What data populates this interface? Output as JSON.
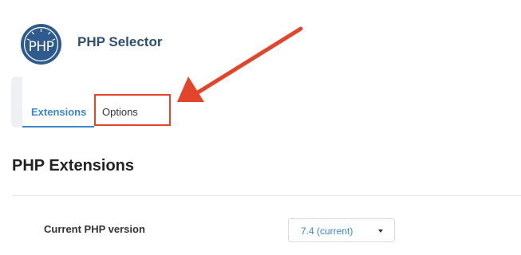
{
  "header": {
    "logo_text": "PHP",
    "logo_icon": "php-logo",
    "title": "PHP Selector"
  },
  "tabs": [
    {
      "label": "Extensions",
      "active": true
    },
    {
      "label": "Options",
      "active": false,
      "highlighted": true
    }
  ],
  "section": {
    "title": "PHP Extensions"
  },
  "php_version": {
    "label": "Current PHP version",
    "selected": "7.4 (current)"
  },
  "colors": {
    "brand": "#2f5a8d",
    "title": "#2e4f72",
    "accent": "#3a86c8",
    "annotation": "#e2442c"
  }
}
